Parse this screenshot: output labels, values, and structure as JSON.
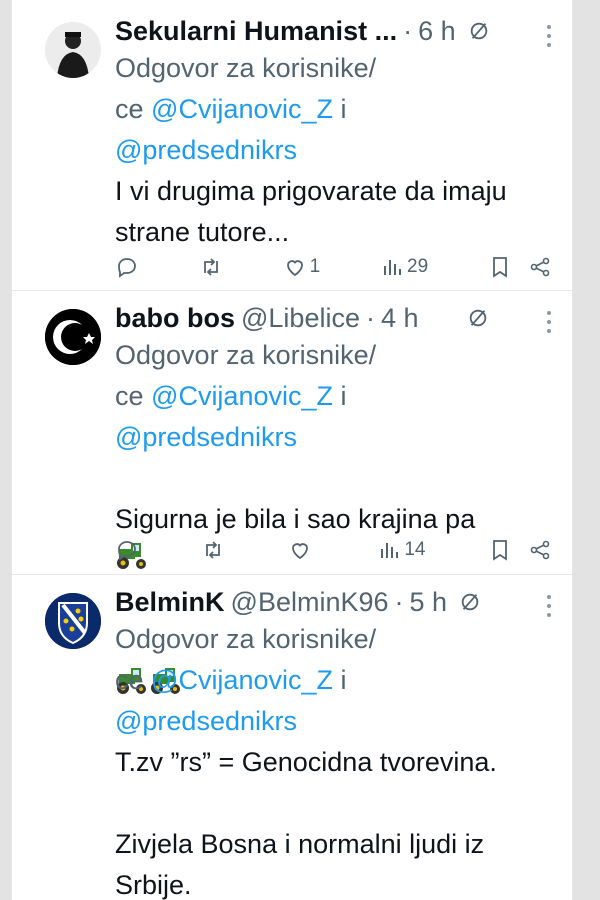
{
  "tweets": [
    {
      "name": "Sekularni Humanist ...",
      "handle": "",
      "time": "6 h",
      "replying_prefix": "Odgovor za korisnike/",
      "replying_mid": "ce ",
      "mention1": "@Cvijanovic_Z",
      "mention_join": " i",
      "mention2": "@predsednikrs",
      "text": "I vi drugima prigovarate da imaju\nstrane tutore...",
      "likes": "1",
      "views": "29"
    },
    {
      "name": "babo bos",
      "handle": "@Libelice",
      "time": "4 h",
      "replying_prefix": "Odgovor za korisnike/",
      "replying_mid": "ce ",
      "mention1": "@Cvijanovic_Z",
      "mention_join": " i",
      "mention2": "@predsednikrs",
      "text": "Sigurna je bila i sao krajina pa",
      "likes": "",
      "views": "14"
    },
    {
      "name": "BelminK",
      "handle": "@BelminK96",
      "time": "5 h",
      "replying_prefix": "Odgovor za korisnike/",
      "replying_mid": "ce ",
      "mention1": "@Cvijanovic_Z",
      "mention_join": " i",
      "mention2": "@predsednikrs",
      "text": "T.zv ”rs” = Genocidna tvorevina.\n\nZivjela Bosna i normalni ljudi iz\nSrbije."
    }
  ],
  "icons": {
    "reply": "reply-icon",
    "retweet": "retweet-icon",
    "like": "heart-icon",
    "views": "views-icon",
    "bookmark": "bookmark-icon",
    "share": "share-icon",
    "grok": "grok-icon",
    "more": "more-icon"
  },
  "colors": {
    "mention": "#1d9bf0",
    "secondary": "#536471",
    "primary": "#0f1419",
    "tractor": "#3a8a2e"
  }
}
